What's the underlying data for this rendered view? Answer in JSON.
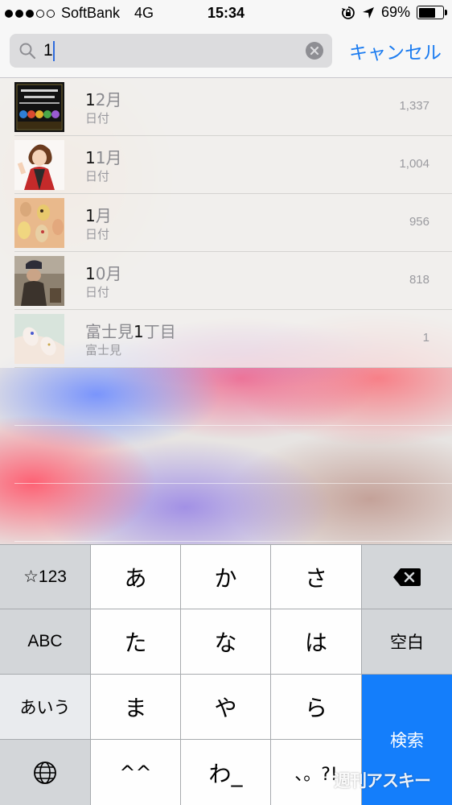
{
  "status_bar": {
    "carrier": "SoftBank",
    "network": "4G",
    "time": "15:34",
    "battery": "69%",
    "battery_level": 0.69,
    "signal_bars_filled": 3,
    "signal_bars_total": 5,
    "icons": [
      "orientation-lock-icon",
      "location-arrow-icon",
      "battery-icon"
    ]
  },
  "search": {
    "value": "1",
    "cancel_label": "キャンセル",
    "accent_color": "#1c7cf0"
  },
  "results": [
    {
      "title_highlight": "1",
      "title_rest": "2月",
      "subtitle": "日付",
      "count": "1,337",
      "thumbnail": "event-banner-thumbnail"
    },
    {
      "title_highlight": "1",
      "title_rest": "1月",
      "subtitle": "日付",
      "count": "1,004",
      "thumbnail": "cartoon-character-thumbnail"
    },
    {
      "title_highlight": "1",
      "title_rest": "月",
      "subtitle": "日付",
      "count": "956",
      "thumbnail": "nail-art-thumbnail"
    },
    {
      "title_highlight": "1",
      "title_rest": "0月",
      "subtitle": "日付",
      "count": "818",
      "thumbnail": "outdoor-photo-thumbnail"
    },
    {
      "title_prefix": "富士見",
      "title_highlight": "1",
      "title_rest": "丁目",
      "subtitle": "富士見",
      "count": "1",
      "thumbnail": "manicure-thumbnail"
    }
  ],
  "keyboard": {
    "numbers_key": "☆123",
    "abc_key": "ABC",
    "aiu_key": "あいう",
    "globe_key_icon": "globe-icon",
    "kana_rows": [
      [
        "あ",
        "か",
        "さ"
      ],
      [
        "た",
        "な",
        "は"
      ],
      [
        "ま",
        "や",
        "ら"
      ],
      [
        "^^",
        "わ_",
        "、。?!"
      ]
    ],
    "delete_key_icon": "delete-icon",
    "space_key": "空白",
    "search_key": "検索",
    "search_key_color": "#147efb"
  },
  "watermark": "週刊アスキー"
}
